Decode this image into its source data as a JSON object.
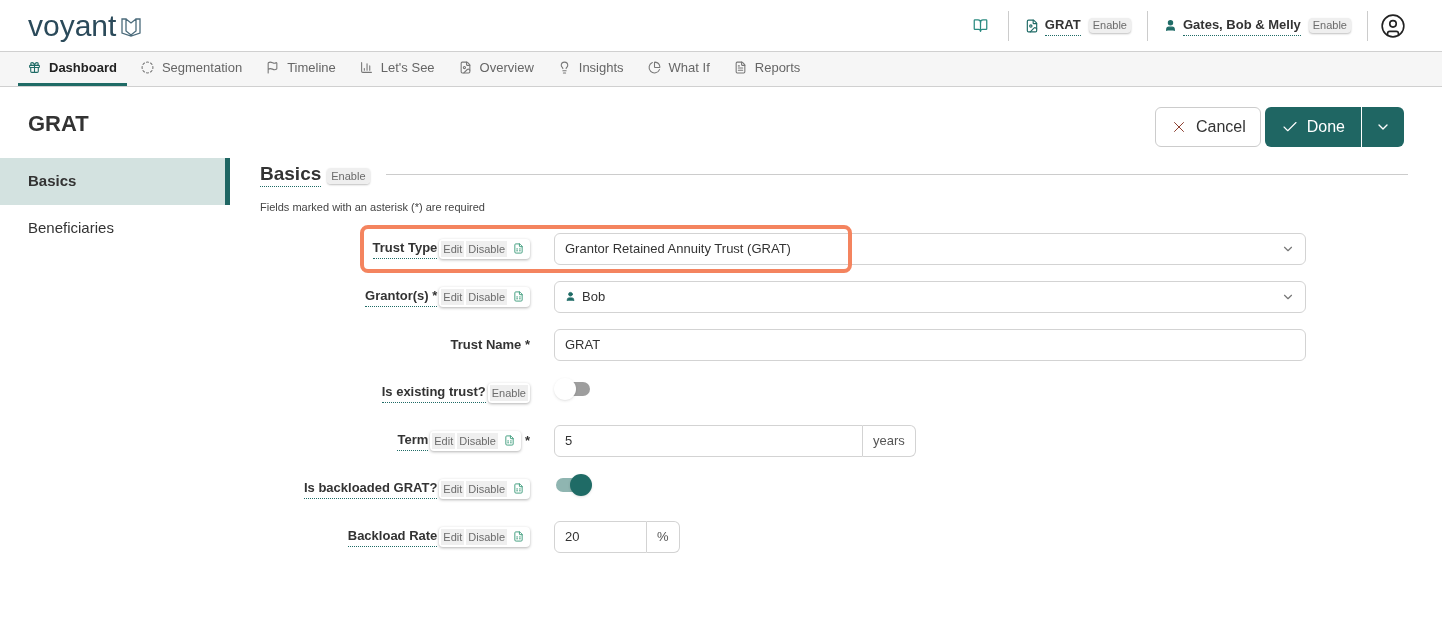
{
  "header": {
    "logo": "voyant",
    "plan": {
      "label": "GRAT",
      "badge": "Enable"
    },
    "client": {
      "label": "Gates, Bob & Melly",
      "badge": "Enable"
    }
  },
  "tabs": [
    {
      "label": "Dashboard",
      "selected": true
    },
    {
      "label": "Segmentation",
      "selected": false
    },
    {
      "label": "Timeline",
      "selected": false
    },
    {
      "label": "Let's See",
      "selected": false
    },
    {
      "label": "Overview",
      "selected": false
    },
    {
      "label": "Insights",
      "selected": false
    },
    {
      "label": "What If",
      "selected": false
    },
    {
      "label": "Reports",
      "selected": false
    }
  ],
  "page": {
    "title": "GRAT",
    "cancel": "Cancel",
    "done": "Done"
  },
  "sidebar": [
    {
      "label": "Basics",
      "selected": true
    },
    {
      "label": "Beneficiaries",
      "selected": false
    }
  ],
  "section": {
    "title": "Basics",
    "badge": "Enable",
    "note": "Fields marked with an asterisk (*) are required"
  },
  "fields": [
    {
      "kind": "select",
      "label": "Trust Type",
      "tools": [
        "Edit",
        "Disable"
      ],
      "doc": true,
      "value": "Grantor Retained Annuity Trust (GRAT)",
      "highlighted": true
    },
    {
      "kind": "select",
      "label": "Grantor(s) *",
      "tools": [
        "Edit",
        "Disable"
      ],
      "doc": true,
      "value": "Bob",
      "person": true,
      "highlighted": false
    },
    {
      "kind": "text",
      "label": "Trust Name *",
      "value": "GRAT",
      "highlighted": false
    },
    {
      "kind": "toggle",
      "label": "Is existing trust?",
      "tools": [
        "Enable"
      ],
      "on": false,
      "highlighted": false
    },
    {
      "kind": "duration",
      "label": "Term",
      "tools": [
        "Edit",
        "Disable"
      ],
      "doc": true,
      "mark": "*",
      "value": "5",
      "unit": "years",
      "highlighted": false
    },
    {
      "kind": "toggle",
      "label": "Is backloaded GRAT?",
      "tools": [
        "Edit",
        "Disable"
      ],
      "doc": true,
      "on": true,
      "highlighted": false
    },
    {
      "kind": "percent",
      "label": "Backload Rate",
      "tools": [
        "Edit",
        "Disable"
      ],
      "doc": true,
      "value": "20",
      "unit": "%",
      "highlighted": false
    }
  ]
}
